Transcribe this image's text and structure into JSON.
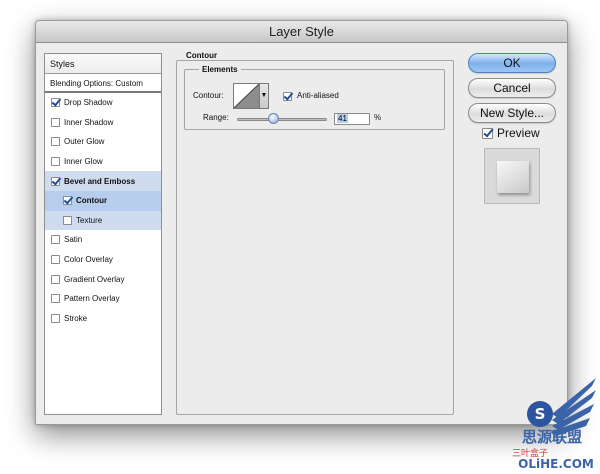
{
  "window": {
    "title": "Layer Style"
  },
  "styles_list": {
    "header": "Styles",
    "blending_options": "Blending Options: Custom",
    "items": [
      {
        "label": "Drop Shadow",
        "checked": true
      },
      {
        "label": "Inner Shadow",
        "checked": false
      },
      {
        "label": "Outer Glow",
        "checked": false
      },
      {
        "label": "Inner Glow",
        "checked": false
      },
      {
        "label": "Bevel and Emboss",
        "checked": true
      },
      {
        "label": "Contour",
        "checked": true
      },
      {
        "label": "Texture",
        "checked": false
      },
      {
        "label": "Satin",
        "checked": false
      },
      {
        "label": "Color Overlay",
        "checked": false
      },
      {
        "label": "Gradient Overlay",
        "checked": false
      },
      {
        "label": "Pattern Overlay",
        "checked": false
      },
      {
        "label": "Stroke",
        "checked": false
      }
    ]
  },
  "contour_panel": {
    "title": "Contour",
    "elements_title": "Elements",
    "contour_label": "Contour:",
    "anti_aliased_label": "Anti-aliased",
    "anti_aliased_checked": true,
    "range_label": "Range:",
    "range_value": "41",
    "range_unit": "%"
  },
  "buttons": {
    "ok": "OK",
    "cancel": "Cancel",
    "new_style": "New Style...",
    "preview_label": "Preview",
    "preview_checked": true
  },
  "watermark": {
    "text_main": "思源联盟",
    "text_sub": "OLiHE.COM",
    "text_tag": "三叶盒子"
  },
  "colors": {
    "accent": "#7fb1ec",
    "selection": "#b6cdee",
    "check": "#1f4f9a"
  }
}
